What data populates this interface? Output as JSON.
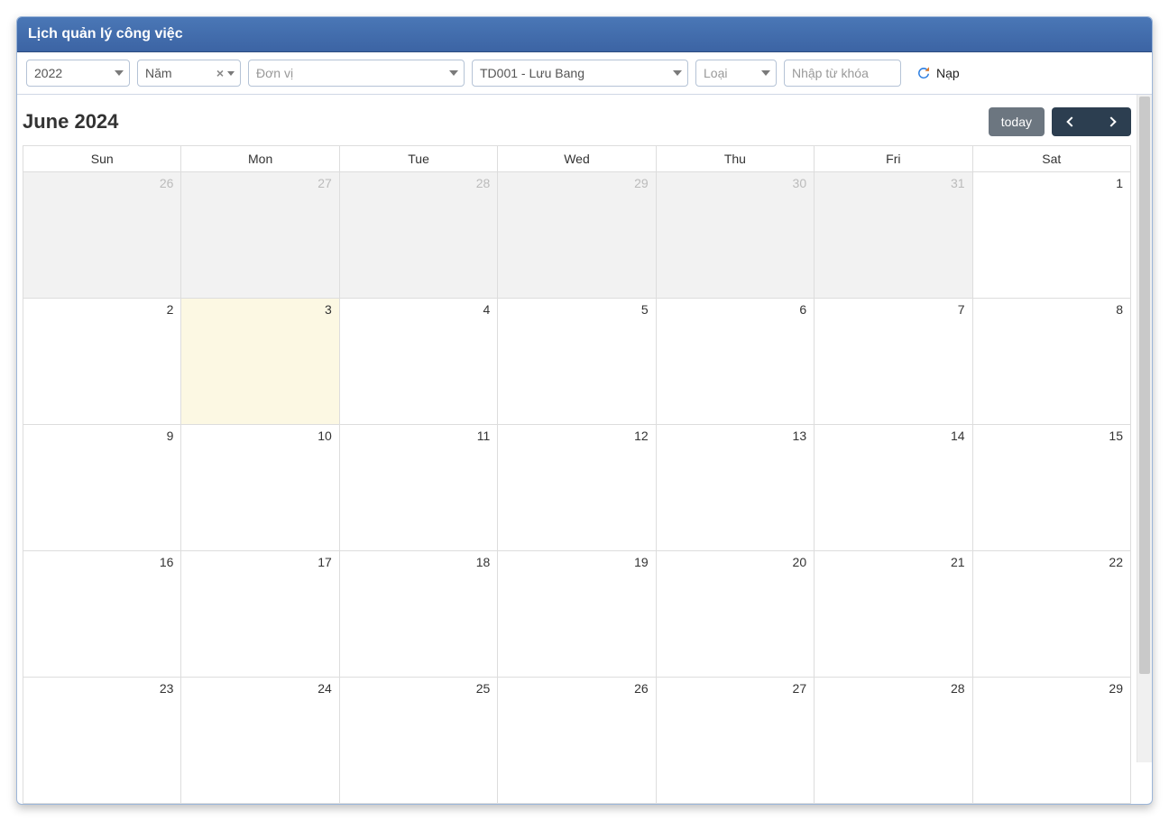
{
  "header": {
    "title": "Lịch quản lý công việc"
  },
  "toolbar": {
    "year": {
      "value": "2022"
    },
    "period": {
      "value": "Năm"
    },
    "unit": {
      "placeholder": "Đơn vị"
    },
    "owner": {
      "value": "TD001 - Lưu Bang"
    },
    "type": {
      "placeholder": "Loại"
    },
    "keyword": {
      "placeholder": "Nhập từ khóa"
    },
    "refresh_label": "Nạp"
  },
  "calendar": {
    "title": "June 2024",
    "today_label": "today",
    "day_headers": [
      "Sun",
      "Mon",
      "Tue",
      "Wed",
      "Thu",
      "Fri",
      "Sat"
    ],
    "weeks": [
      [
        {
          "n": "26",
          "other": true
        },
        {
          "n": "27",
          "other": true
        },
        {
          "n": "28",
          "other": true
        },
        {
          "n": "29",
          "other": true
        },
        {
          "n": "30",
          "other": true
        },
        {
          "n": "31",
          "other": true
        },
        {
          "n": "1",
          "other": false
        }
      ],
      [
        {
          "n": "2",
          "other": false
        },
        {
          "n": "3",
          "other": false,
          "today": true
        },
        {
          "n": "4",
          "other": false
        },
        {
          "n": "5",
          "other": false
        },
        {
          "n": "6",
          "other": false
        },
        {
          "n": "7",
          "other": false
        },
        {
          "n": "8",
          "other": false
        }
      ],
      [
        {
          "n": "9",
          "other": false
        },
        {
          "n": "10",
          "other": false
        },
        {
          "n": "11",
          "other": false
        },
        {
          "n": "12",
          "other": false
        },
        {
          "n": "13",
          "other": false
        },
        {
          "n": "14",
          "other": false
        },
        {
          "n": "15",
          "other": false
        }
      ],
      [
        {
          "n": "16",
          "other": false
        },
        {
          "n": "17",
          "other": false
        },
        {
          "n": "18",
          "other": false
        },
        {
          "n": "19",
          "other": false
        },
        {
          "n": "20",
          "other": false
        },
        {
          "n": "21",
          "other": false
        },
        {
          "n": "22",
          "other": false
        }
      ],
      [
        {
          "n": "23",
          "other": false
        },
        {
          "n": "24",
          "other": false
        },
        {
          "n": "25",
          "other": false
        },
        {
          "n": "26",
          "other": false
        },
        {
          "n": "27",
          "other": false
        },
        {
          "n": "28",
          "other": false
        },
        {
          "n": "29",
          "other": false
        }
      ]
    ]
  }
}
